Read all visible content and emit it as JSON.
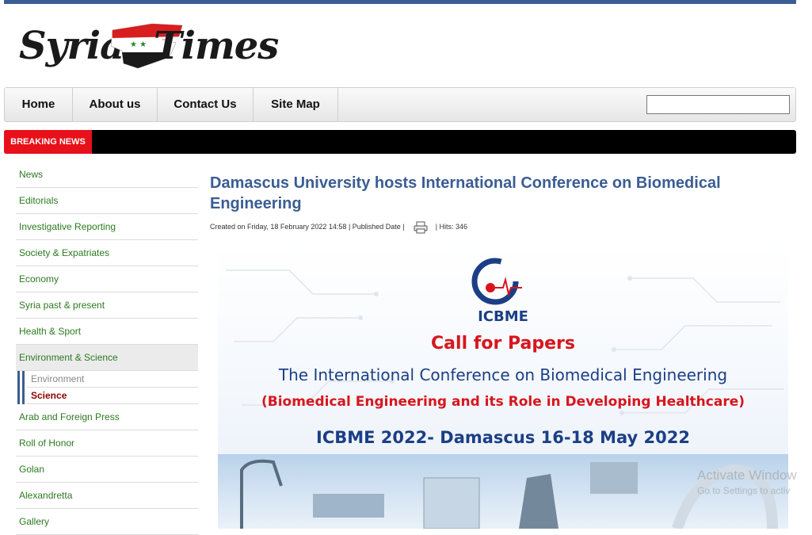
{
  "brand": {
    "logo_word_1": "Syria",
    "logo_word_2": "Times"
  },
  "nav": {
    "items": [
      {
        "label": "Home"
      },
      {
        "label": "About us"
      },
      {
        "label": "Contact Us"
      },
      {
        "label": "Site Map"
      }
    ],
    "search": {
      "value": "",
      "placeholder": ""
    }
  },
  "ticker": {
    "label": "BREAKING NEWS"
  },
  "sidebar": {
    "items": [
      {
        "label": "News"
      },
      {
        "label": "Editorials"
      },
      {
        "label": "Investigative Reporting"
      },
      {
        "label": "Society & Expatriates"
      },
      {
        "label": "Economy"
      },
      {
        "label": "Syria past & present"
      },
      {
        "label": "Health & Sport"
      },
      {
        "label": "Environment & Science"
      },
      {
        "label": "Arab and Foreign Press"
      },
      {
        "label": "Roll of Honor"
      },
      {
        "label": "Golan"
      },
      {
        "label": "Alexandretta"
      },
      {
        "label": "Gallery"
      }
    ],
    "subitems": [
      {
        "label": "Environment"
      },
      {
        "label": "Science"
      }
    ]
  },
  "article": {
    "title": "Damascus University hosts International Conference on Biomedical Engineering",
    "meta_created": "Created on Friday, 18 February 2022 14:58  |  Published Date  |",
    "meta_hits": "|  Hits: 346",
    "poster": {
      "acronym": "ICBME",
      "call": "Call for Papers",
      "conference": "The International Conference on Biomedical Engineering",
      "theme": "(Biomedical Engineering and its Role in Developing Healthcare)",
      "dates": "ICBME 2022- Damascus  16-18 May 2022"
    }
  },
  "os_overlay": {
    "line1": "Activate Window",
    "line2": "Go to Settings to activ"
  },
  "colors": {
    "accent": "#3a5d93",
    "link_green": "#2c7a20",
    "breaking_red": "#e8101a",
    "poster_red": "#d8151d",
    "poster_blue": "#1b3f86"
  }
}
